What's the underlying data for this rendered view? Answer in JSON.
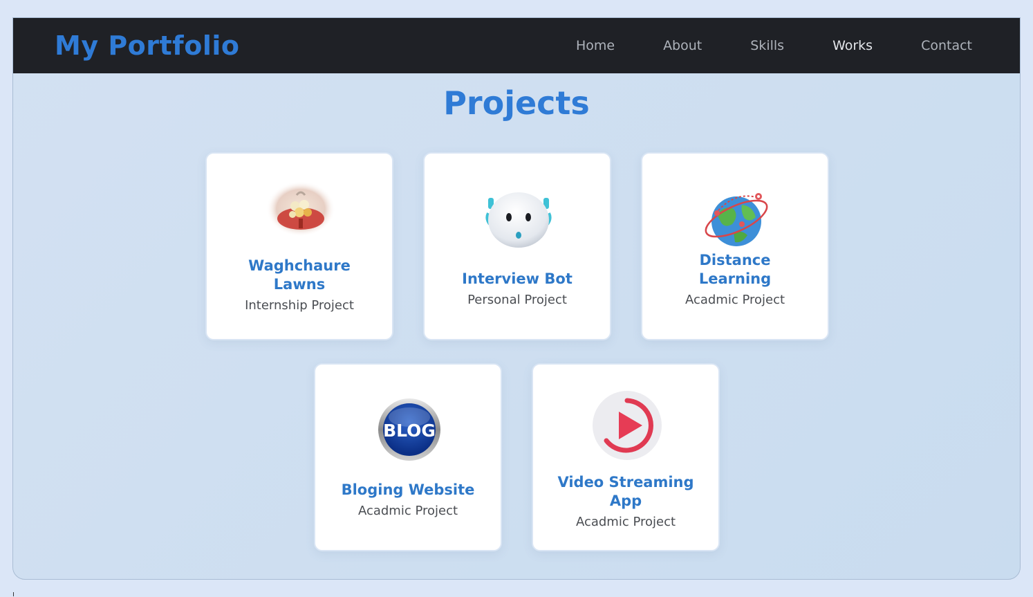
{
  "navbar": {
    "brand": "My Portfolio",
    "links": [
      "Home",
      "About",
      "Skills",
      "Works",
      "Contact"
    ],
    "active": "Works"
  },
  "section": {
    "title": "Projects"
  },
  "projects": [
    {
      "title": "Waghchaure Lawns",
      "type": "Internship Project",
      "icon": "flower-bouquet-image"
    },
    {
      "title": "Interview Bot",
      "type": "Personal Project",
      "icon": "robot-icon"
    },
    {
      "title": "Distance Learning",
      "type": "Acadmic Project",
      "icon": "globe-icon"
    },
    {
      "title": "Bloging Website",
      "type": "Acadmic Project",
      "icon": "blog-badge-icon",
      "icon_text": "BLOG"
    },
    {
      "title": "Video Streaming App",
      "type": "Acadmic Project",
      "icon": "play-icon"
    }
  ],
  "colors": {
    "accent": "#2f7bd6",
    "nav_bg": "#1f2126",
    "page_bg": "#d3e1f2"
  }
}
